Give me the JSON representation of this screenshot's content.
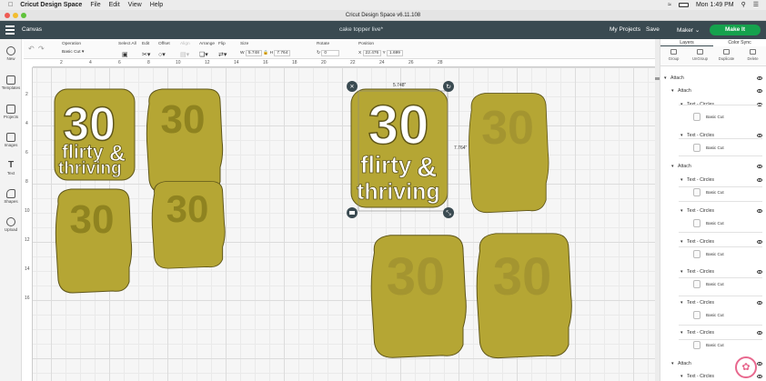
{
  "mac_menu": {
    "app": "Cricut Design Space",
    "items": [
      "File",
      "Edit",
      "View",
      "Help"
    ],
    "clock": "Mon 1:49 PM"
  },
  "window_title": "Cricut Design Space  v6.11.108",
  "header": {
    "section": "Canvas",
    "project_name": "cake topper live*",
    "my_projects": "My Projects",
    "save": "Save",
    "maker": "Maker",
    "make_it": "Make It"
  },
  "toolbar": {
    "operation_label": "Operation",
    "operation_value": "Basic Cut",
    "select_all": "Select All",
    "edit": "Edit",
    "offset": "Offset",
    "align": "Align",
    "arrange": "Arrange",
    "flip": "Flip",
    "size_label": "Size",
    "w_label": "W",
    "w_value": "5.748",
    "h_label": "H",
    "h_value": "7.764",
    "rotate_label": "Rotate",
    "rotate_value": "0",
    "position_label": "Position",
    "x_label": "X",
    "x_value": "22.476",
    "y_label": "Y",
    "y_value": "1.699"
  },
  "left_nav": [
    "New",
    "Templates",
    "Projects",
    "Images",
    "Text",
    "Shapes",
    "Upload"
  ],
  "ruler_top": [
    "2",
    "4",
    "6",
    "8",
    "10",
    "12",
    "14",
    "16",
    "18",
    "20",
    "22",
    "24",
    "26",
    "28"
  ],
  "ruler_left": [
    "2",
    "4",
    "6",
    "8",
    "10",
    "12",
    "14",
    "16"
  ],
  "selection": {
    "width_label": "5.748\"",
    "height_label": "7.764\""
  },
  "design": {
    "number": "30",
    "line1": "flirty",
    "amp": "&",
    "line2": "thriving"
  },
  "panel": {
    "tabs": [
      "Layers",
      "Color Sync"
    ],
    "actions": [
      "Group",
      "UnGroup",
      "Duplicate",
      "Delete"
    ]
  },
  "layers": [
    {
      "label": "Attach",
      "indent": 0,
      "arrow": true
    },
    {
      "label": "Attach",
      "indent": 1,
      "arrow": true
    },
    {
      "label": "Text - Circles",
      "indent": 2,
      "arrow": true
    },
    {
      "label": "Basic Cut",
      "indent": 3,
      "thumb": true
    },
    {
      "label": "Text - Circles",
      "indent": 2,
      "arrow": true
    },
    {
      "label": "Basic Cut",
      "indent": 3,
      "thumb": true
    },
    {
      "label": "Attach",
      "indent": 1,
      "arrow": true
    },
    {
      "label": "Text - Circles",
      "indent": 2,
      "arrow": true
    },
    {
      "label": "Basic Cut",
      "indent": 3,
      "thumb": true
    },
    {
      "label": "Text - Circles",
      "indent": 2,
      "arrow": true
    },
    {
      "label": "Basic Cut",
      "indent": 3,
      "thumb": true
    },
    {
      "label": "Text - Circles",
      "indent": 2,
      "arrow": true
    },
    {
      "label": "Basic Cut",
      "indent": 3,
      "thumb": true
    },
    {
      "label": "Text - Circles",
      "indent": 2,
      "arrow": true
    },
    {
      "label": "Basic Cut",
      "indent": 3,
      "thumb": true
    },
    {
      "label": "Text - Circles",
      "indent": 2,
      "arrow": true
    },
    {
      "label": "Basic Cut",
      "indent": 3,
      "thumb": true
    },
    {
      "label": "Text - Circles",
      "indent": 2,
      "arrow": true
    },
    {
      "label": "Basic Cut",
      "indent": 3,
      "thumb": true
    },
    {
      "label": "Attach",
      "indent": 1,
      "arrow": true
    },
    {
      "label": "Text - Circles",
      "indent": 2,
      "arrow": true
    }
  ],
  "colors": {
    "gold": "#b5a634",
    "header": "#3a4a51",
    "make_it": "#15a24d"
  }
}
